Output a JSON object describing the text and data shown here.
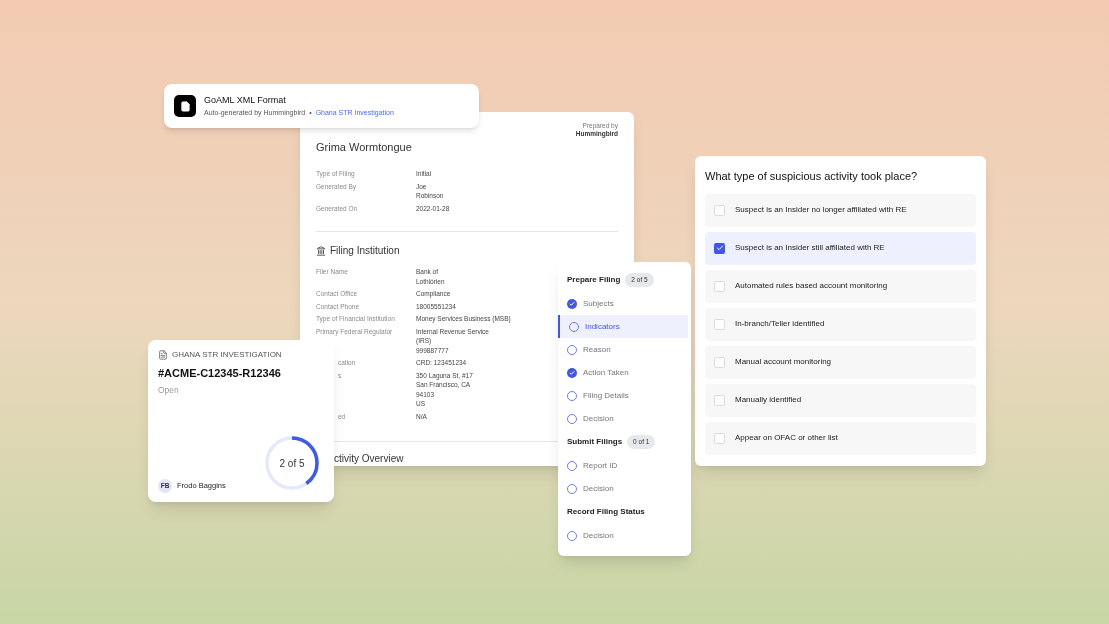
{
  "format_card": {
    "title": "GoAML XML Format",
    "subtitle": "Auto-generated by Hummingbird",
    "separator": "•",
    "link": "Ghana STR Investigation"
  },
  "document": {
    "prepared_by": "Prepared by",
    "logo": "Hummingbird",
    "name": "Grima Wormtongue",
    "summary": [
      {
        "label": "Type of Filing",
        "lines": [
          "Initial"
        ]
      },
      {
        "label": "Generated By",
        "lines": [
          "Joe",
          "Robinson"
        ]
      },
      {
        "label": "Generated On",
        "lines": [
          "2022-01-28"
        ]
      }
    ],
    "institution": {
      "title": "Filing Institution",
      "rows": [
        {
          "kind": "full",
          "label": "Filer Name",
          "lines": [
            "Bank of",
            "Lothlórien"
          ]
        },
        {
          "kind": "full",
          "label": "Contact Office",
          "lines": [
            "Compliance"
          ]
        },
        {
          "kind": "full",
          "label": "Contact Phone",
          "lines": [
            "18005551234"
          ]
        },
        {
          "kind": "full",
          "label": "Type of Financial Institution",
          "lines": [
            "Money Services Business (MSB)"
          ]
        },
        {
          "kind": "full",
          "label": "Primary Federal Regulator",
          "lines": [
            "Internal Revenue Service",
            "(IRS)",
            "999887777"
          ]
        },
        {
          "kind": "cut",
          "label": "cation",
          "lines": [
            "CRD: 123451234"
          ]
        },
        {
          "kind": "cut",
          "label": "s",
          "lines": [
            "350 Laguna St, #17",
            "San Francisco, CA",
            "94103",
            "US"
          ]
        },
        {
          "kind": "cut",
          "label": "ed",
          "lines": [
            "N/A"
          ]
        }
      ]
    },
    "next_section": "ctivity Overview"
  },
  "case_card": {
    "category": "GHANA STR INVESTIGATION",
    "case_id": "#ACME-C12345-R12346",
    "status": "Open",
    "progress": {
      "text": "2 of 5",
      "level": 0.4
    },
    "assignee": {
      "initials": "FB",
      "name": "Frodo Baggins"
    }
  },
  "steps": [
    {
      "title": "Prepare Filing",
      "badge": "2 of 5",
      "items": [
        {
          "label": "Subjects",
          "done": true,
          "selected": false
        },
        {
          "label": "Indicators",
          "done": false,
          "selected": true
        },
        {
          "label": "Reason",
          "done": false,
          "selected": false
        },
        {
          "label": "Action Taken",
          "done": true,
          "selected": false
        },
        {
          "label": "Filing Details",
          "done": false,
          "selected": false
        },
        {
          "label": "Decision",
          "done": false,
          "selected": false
        }
      ]
    },
    {
      "title": "Submit Filings",
      "badge": "0 of 1",
      "items": [
        {
          "label": "Report ID",
          "done": false,
          "selected": false
        },
        {
          "label": "Decision",
          "done": false,
          "selected": false
        }
      ]
    },
    {
      "title": "Record Filing Status",
      "items": [
        {
          "label": "Decision",
          "done": false,
          "selected": false
        }
      ]
    }
  ],
  "question": {
    "title": "What type of suspicious activity took place?",
    "options": [
      {
        "label": "Suspect is an Insider no longer affiliated with RE",
        "checked": false
      },
      {
        "label": "Suspect is an Insider still affiliated with RE",
        "checked": true
      },
      {
        "label": "Automated rules based account monitoring",
        "checked": false
      },
      {
        "label": "In-branch/Teller identified",
        "checked": false
      },
      {
        "label": "Manual account monitoring",
        "checked": false
      },
      {
        "label": "Manually identified",
        "checked": false
      },
      {
        "label": "Appear on OFAC or other list",
        "checked": false
      }
    ]
  }
}
